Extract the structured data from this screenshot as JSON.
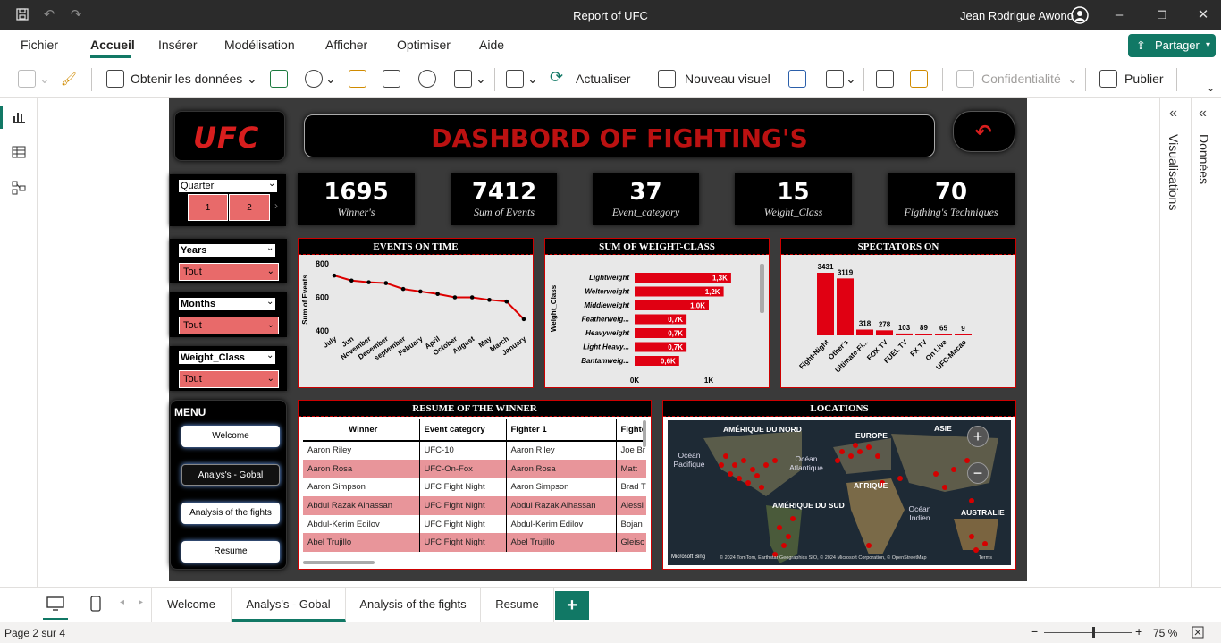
{
  "window": {
    "title": "Report of UFC",
    "user": "Jean Rodrigue Awono"
  },
  "menu": [
    "Fichier",
    "Accueil",
    "Insérer",
    "Modélisation",
    "Afficher",
    "Optimiser",
    "Aide"
  ],
  "share_label": "Partager",
  "ribbon": {
    "get_data": "Obtenir les données",
    "refresh": "Actualiser",
    "new_visual": "Nouveau visuel",
    "confidentiality": "Confidentialité",
    "publish": "Publier"
  },
  "right_pane": {
    "visualizations": "Visualisations",
    "data": "Données"
  },
  "tabs": [
    "Welcome",
    "Analys's - Gobal",
    "Analysis of the fights",
    "Resume"
  ],
  "status": {
    "page": "Page 2 sur 4",
    "zoom": "75 %",
    "zoom_fraction": 0.55
  },
  "dashboard": {
    "logo": "UFC",
    "title": "DASHBORD OF FIGHTING'S",
    "quarter": {
      "title": "Quarter",
      "buttons": [
        "1",
        "2"
      ]
    },
    "kpis": [
      {
        "value": "1695",
        "label": "Winner's"
      },
      {
        "value": "7412",
        "label": "Sum of  Events"
      },
      {
        "value": "37",
        "label": "Event_category"
      },
      {
        "value": "15",
        "label": "Weight_Class"
      },
      {
        "value": "70",
        "label": "Figthing's Techniques"
      }
    ],
    "slicers": [
      {
        "title": "Years",
        "value": "Tout"
      },
      {
        "title": "Months",
        "value": "Tout"
      },
      {
        "title": "Weight_Class",
        "value": "Tout"
      }
    ],
    "menu": {
      "title": "MENU",
      "buttons": [
        "Welcome",
        "Analys's - Gobal",
        "Analysis of the fights",
        "Resume"
      ]
    },
    "table": {
      "title": "RESUME OF THE WINNER",
      "columns": [
        "Winner",
        "Event category",
        "Fighter 1",
        "Fighte"
      ],
      "rows": [
        [
          "Aaron Riley",
          "UFC-10",
          "Aaron Riley",
          "Joe Br"
        ],
        [
          "Aaron Rosa",
          "UFC-On-Fox",
          "Aaron Rosa",
          "Matt"
        ],
        [
          "Aaron Simpson",
          "UFC Fight Night",
          "Aaron Simpson",
          "Brad T"
        ],
        [
          "Abdul Razak Alhassan",
          "UFC Fight Night",
          "Abdul Razak Alhassan",
          "Alessi"
        ],
        [
          "Abdul-Kerim Edilov",
          "UFC Fight Night",
          "Abdul-Kerim Edilov",
          "Bojan"
        ],
        [
          "Abel Trujillo",
          "UFC Fight Night",
          "Abel Trujillo",
          "Gleisc"
        ]
      ]
    },
    "map": {
      "title": "LOCATIONS",
      "labels": [
        "AMÉRIQUE DU NORD",
        "EUROPE",
        "ASIE",
        "AFRIQUE",
        "AMÉRIQUE DU SUD",
        "AUSTRALIE"
      ],
      "oceans": [
        "Océan Pacifique",
        "Océan Atlantique",
        "Océan Indien"
      ],
      "attribution": "© 2024 TomTom, Earthstar Geographics SIO, © 2024 Microsoft Corporation, © OpenStreetMap",
      "terms": "Terms",
      "bing": "Microsoft Bing"
    }
  },
  "chart_data": [
    {
      "type": "line",
      "title": "EVENTS ON TIME",
      "ylabel": "Sum of Events",
      "categories": [
        "July",
        "Jun",
        "November",
        "December",
        "september",
        "Febuary",
        "April",
        "October",
        "August",
        "May",
        "March",
        "January"
      ],
      "values": [
        730,
        700,
        690,
        685,
        650,
        635,
        620,
        600,
        600,
        585,
        575,
        470
      ],
      "ylim": [
        400,
        800
      ],
      "yticks": [
        "400",
        "600",
        "800"
      ]
    },
    {
      "type": "bar",
      "title": "SUM OF WEIGHT-CLASS",
      "ylabel": "Weight_Class",
      "categories": [
        "Lightweight",
        "Welterweight",
        "Middleweight",
        "Featherweig...",
        "Heavyweight",
        "Light Heavy...",
        "Bantamweig..."
      ],
      "values": [
        1300,
        1200,
        1000,
        700,
        700,
        700,
        600
      ],
      "data_labels": [
        "1,3K",
        "1,2K",
        "1,0K",
        "0,7K",
        "0,7K",
        "0,7K",
        "0,6K"
      ],
      "xticks": [
        "0K",
        "1K"
      ],
      "xlim": [
        0,
        1000
      ]
    },
    {
      "type": "bar",
      "title": "SPECTATORS ON",
      "categories": [
        "Fight-Night",
        "Other's",
        "Ultimate-Fi...",
        "FOX TV",
        "FUEL TV",
        "FX TV",
        "On Live",
        "UFC-Macao"
      ],
      "values": [
        3431,
        3119,
        318,
        278,
        103,
        89,
        65,
        9
      ],
      "ylim": [
        0,
        3431
      ]
    }
  ]
}
